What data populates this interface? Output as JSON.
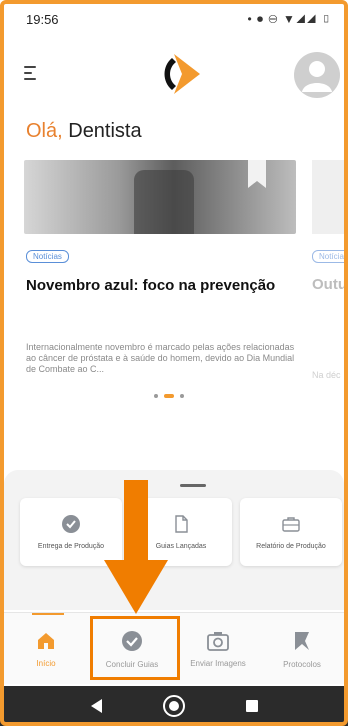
{
  "status_bar": {
    "time": "19:56",
    "icons": "• ⏺ ⊖ ▼◢◢ ▯"
  },
  "header": {
    "menu_icon": "menu-icon",
    "logo": "orange-logo",
    "avatar_icon": "user-avatar-icon"
  },
  "greeting": {
    "hello": "Olá,",
    "name": " Dentista"
  },
  "news": {
    "tag": "Notícias",
    "title": "Novembro azul: foco na prevenção",
    "body": "Internacionalmente novembro é marcado pelas ações relacionadas ao câncer de próstata e à saúde do homem, devido ao Dia Mundial de Combate ao C...",
    "peek_tag": "Notícia",
    "peek_title": "Outu",
    "peek_body": "Na déc"
  },
  "quick_actions": [
    {
      "label": "Entrega de Produção",
      "icon": "check-circle-icon"
    },
    {
      "label": "Guias Lançadas",
      "icon": "document-icon"
    },
    {
      "label": "Relatório de Produção",
      "icon": "briefcase-icon"
    }
  ],
  "bottom_nav": [
    {
      "label": "Início",
      "icon": "home-icon",
      "active": true
    },
    {
      "label": "Concluir Guias",
      "icon": "check-circle-icon",
      "active": false
    },
    {
      "label": "Enviar Imagens",
      "icon": "camera-icon",
      "active": false
    },
    {
      "label": "Protocolos",
      "icon": "protocol-icon",
      "active": false
    }
  ],
  "colors": {
    "accent": "#f39a2e",
    "tag_blue": "#5a8fd8",
    "annotation": "#f07d00"
  }
}
